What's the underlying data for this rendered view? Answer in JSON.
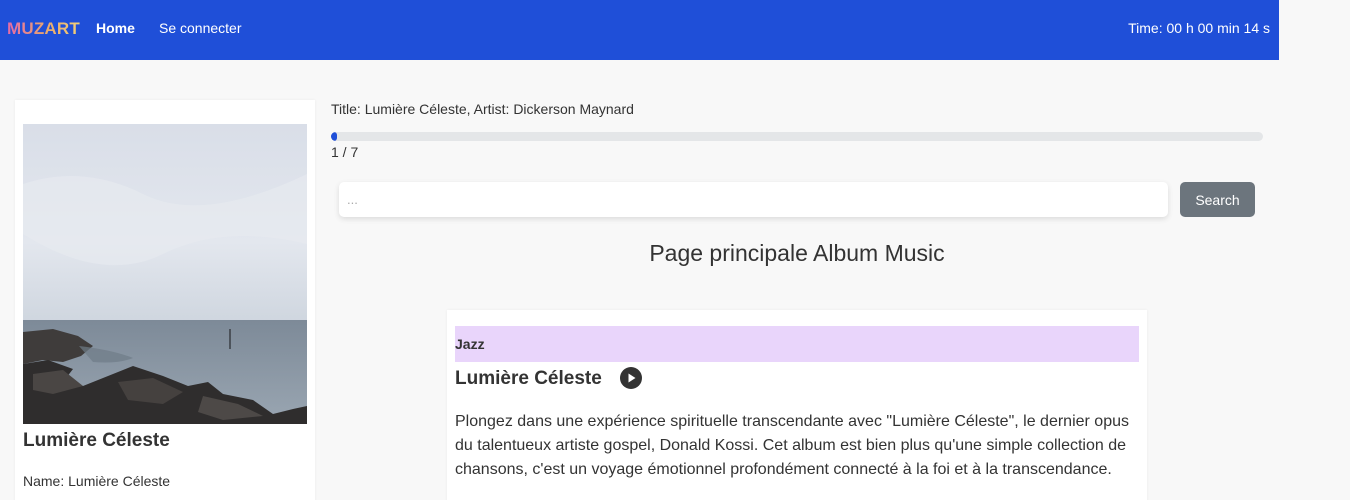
{
  "navbar": {
    "brand": "MUZART",
    "links": [
      {
        "label": "Home"
      },
      {
        "label": "Se connecter"
      }
    ],
    "timer": "Time: 00 h 00 min 14 s"
  },
  "sidebar_card": {
    "title": "Lumière Céleste",
    "name": "Name: Lumière Céleste"
  },
  "player": {
    "now_playing": "Title: Lumière Céleste, Artist: Dickerson Maynard",
    "progress_fraction": 0.0,
    "page_counter": "1 / 7"
  },
  "search": {
    "placeholder": "...",
    "button_label": "Search"
  },
  "main": {
    "heading": "Page principale Album Music"
  },
  "album_card": {
    "genre": "Jazz",
    "title": "Lumière Céleste",
    "description": "Plongez dans une expérience spirituelle transcendante avec \"Lumière Céleste\", le dernier opus du talentueux artiste gospel, Donald Kossi. Cet album est bien plus qu'une simple collection de chansons, c'est un voyage émotionnel profondément connecté à la foi et à la transcendance."
  },
  "colors": {
    "navbar": "#1f4fd8",
    "genre_bar": "#e9d5fb",
    "search_button": "#6c757d",
    "progress": "#1f4fd8"
  },
  "icons": {
    "play": "play-circle-icon"
  }
}
